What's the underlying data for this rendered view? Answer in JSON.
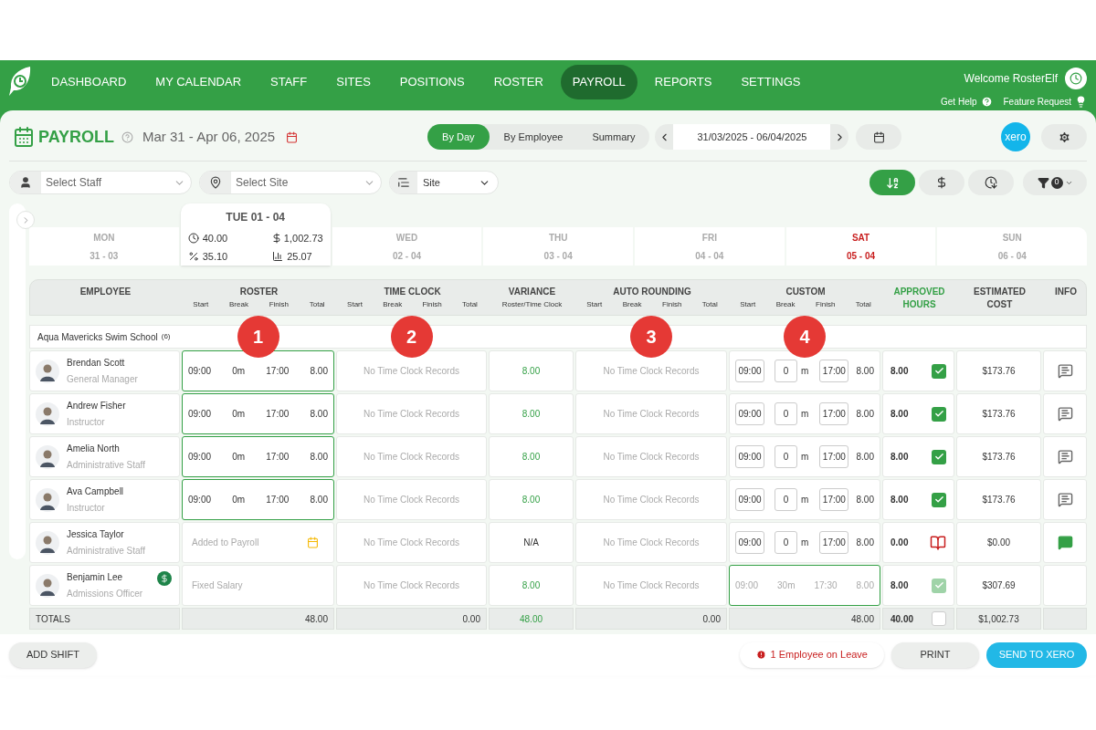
{
  "nav": {
    "items": [
      {
        "label": "DASHBOARD",
        "selected": false
      },
      {
        "label": "MY CALENDAR",
        "selected": false
      },
      {
        "label": "STAFF",
        "selected": false
      },
      {
        "label": "SITES",
        "selected": false
      },
      {
        "label": "POSITIONS",
        "selected": false
      },
      {
        "label": "ROSTER",
        "selected": false
      },
      {
        "label": "PAYROLL",
        "selected": true
      },
      {
        "label": "REPORTS",
        "selected": false
      },
      {
        "label": "SETTINGS",
        "selected": false
      }
    ],
    "welcome": "Welcome RosterElf",
    "help": "Get Help",
    "feature": "Feature Request"
  },
  "header": {
    "title": "PAYROLL",
    "period": "Mar 31 - Apr 06, 2025",
    "views": [
      {
        "label": "By Day",
        "selected": true
      },
      {
        "label": "By Employee",
        "selected": false
      },
      {
        "label": "Summary",
        "selected": false
      }
    ],
    "range": "31/03/2025 - 06/04/2025",
    "xero": "xero"
  },
  "filters": {
    "staff": {
      "placeholder": "Select Staff"
    },
    "site": {
      "placeholder": "Select Site"
    },
    "group_by": "Site"
  },
  "tools": [
    {
      "kind": "sort-name",
      "selected": true
    },
    {
      "kind": "cost",
      "selected": false
    },
    {
      "kind": "sort-time",
      "selected": false
    }
  ],
  "filter_count": "0",
  "days": [
    {
      "day": "MON",
      "date": "31 - 03",
      "selected": false,
      "highlighted": false
    },
    {
      "day": "TUE",
      "date": "01 - 04",
      "selected": true,
      "highlighted": false,
      "hours": "40.00",
      "cost": "1,002.73",
      "percent": "35.10",
      "average": "25.07"
    },
    {
      "day": "WED",
      "date": "02 - 04",
      "selected": false,
      "highlighted": false
    },
    {
      "day": "THU",
      "date": "03 - 04",
      "selected": false,
      "highlighted": false
    },
    {
      "day": "FRI",
      "date": "04 - 04",
      "selected": false,
      "highlighted": false
    },
    {
      "day": "SAT",
      "date": "05 - 04",
      "selected": false,
      "highlighted": true
    },
    {
      "day": "SUN",
      "date": "06 - 04",
      "selected": false,
      "highlighted": false
    }
  ],
  "columns": [
    {
      "title": "EMPLOYEE",
      "highlighted": false
    },
    {
      "title": "ROSTER",
      "sub": [
        "Start",
        "Break",
        "Finish",
        "Total"
      ],
      "marker": "1",
      "highlighted": false
    },
    {
      "title": "TIME CLOCK",
      "sub": [
        "Start",
        "Break",
        "Finish",
        "Total"
      ],
      "marker": "2",
      "highlighted": false
    },
    {
      "title": "VARIANCE",
      "sub": [
        "Roster/Time Clock"
      ],
      "highlighted": false
    },
    {
      "title": "AUTO ROUNDING",
      "sub": [
        "Start",
        "Break",
        "Finish",
        "Total"
      ],
      "marker": "3",
      "highlighted": false
    },
    {
      "title": "CUSTOM",
      "sub": [
        "Start",
        "Break",
        "Finish",
        "Total"
      ],
      "marker": "4",
      "highlighted": false
    },
    {
      "title": "APPROVED HOURS",
      "highlighted": true
    },
    {
      "title": "ESTIMATED COST",
      "highlighted": false
    },
    {
      "title": "INFO",
      "highlighted": false
    }
  ],
  "group": {
    "name": "Aqua Mavericks Swim School",
    "count": "(6)"
  },
  "rows": [
    {
      "name": "Brendan Scott",
      "role": "General Manager",
      "salary_badge": false,
      "roster": {
        "kind": "shift",
        "start": "09:00",
        "break": "0m",
        "finish": "17:00",
        "total": "8.00",
        "highlighted": true
      },
      "timeclock": "No Time Clock Records",
      "variance": {
        "text": "8.00",
        "kind": "match"
      },
      "rounding": "No Time Clock Records",
      "custom": {
        "kind": "inputs",
        "start": "09:00",
        "break": "0",
        "unit": "m",
        "finish": "17:00",
        "total": "8.00",
        "highlighted": false
      },
      "approved": "8.00",
      "approval": {
        "kind": "checkbox",
        "checked": true,
        "disabled": false
      },
      "cost": "$173.76",
      "info": {
        "kind": "comment",
        "filled": false
      }
    },
    {
      "name": "Andrew Fisher",
      "role": "Instructor",
      "salary_badge": false,
      "roster": {
        "kind": "shift",
        "start": "09:00",
        "break": "0m",
        "finish": "17:00",
        "total": "8.00",
        "highlighted": true
      },
      "timeclock": "No Time Clock Records",
      "variance": {
        "text": "8.00",
        "kind": "match"
      },
      "rounding": "No Time Clock Records",
      "custom": {
        "kind": "inputs",
        "start": "09:00",
        "break": "0",
        "unit": "m",
        "finish": "17:00",
        "total": "8.00",
        "highlighted": false
      },
      "approved": "8.00",
      "approval": {
        "kind": "checkbox",
        "checked": true,
        "disabled": false
      },
      "cost": "$173.76",
      "info": {
        "kind": "comment",
        "filled": false
      }
    },
    {
      "name": "Amelia North",
      "role": "Administrative Staff",
      "salary_badge": false,
      "roster": {
        "kind": "shift",
        "start": "09:00",
        "break": "0m",
        "finish": "17:00",
        "total": "8.00",
        "highlighted": true
      },
      "timeclock": "No Time Clock Records",
      "variance": {
        "text": "8.00",
        "kind": "match"
      },
      "rounding": "No Time Clock Records",
      "custom": {
        "kind": "inputs",
        "start": "09:00",
        "break": "0",
        "unit": "m",
        "finish": "17:00",
        "total": "8.00",
        "highlighted": false
      },
      "approved": "8.00",
      "approval": {
        "kind": "checkbox",
        "checked": true,
        "disabled": false
      },
      "cost": "$173.76",
      "info": {
        "kind": "comment",
        "filled": false
      }
    },
    {
      "name": "Ava Campbell",
      "role": "Instructor",
      "salary_badge": false,
      "roster": {
        "kind": "shift",
        "start": "09:00",
        "break": "0m",
        "finish": "17:00",
        "total": "8.00",
        "highlighted": true
      },
      "timeclock": "No Time Clock Records",
      "variance": {
        "text": "8.00",
        "kind": "match"
      },
      "rounding": "No Time Clock Records",
      "custom": {
        "kind": "inputs",
        "start": "09:00",
        "break": "0",
        "unit": "m",
        "finish": "17:00",
        "total": "8.00",
        "highlighted": false
      },
      "approved": "8.00",
      "approval": {
        "kind": "checkbox",
        "checked": true,
        "disabled": false
      },
      "cost": "$173.76",
      "info": {
        "kind": "comment",
        "filled": false
      }
    },
    {
      "name": "Jessica Taylor",
      "role": "Administrative Staff",
      "salary_badge": false,
      "roster": {
        "kind": "note",
        "text": "Added to Payroll",
        "calendar": true,
        "highlighted": false
      },
      "timeclock": "No Time Clock Records",
      "variance": {
        "text": "N/A",
        "kind": "none"
      },
      "rounding": "No Time Clock Records",
      "custom": {
        "kind": "inputs",
        "start": "09:00",
        "break": "0",
        "unit": "m",
        "finish": "17:00",
        "total": "8.00",
        "highlighted": false
      },
      "approved": "0.00",
      "approval": {
        "kind": "leave"
      },
      "cost": "$0.00",
      "info": {
        "kind": "comment",
        "filled": true
      }
    },
    {
      "name": "Benjamin Lee",
      "role": "Admissions Officer",
      "salary_badge": true,
      "roster": {
        "kind": "note",
        "text": "Fixed Salary",
        "calendar": false,
        "highlighted": false
      },
      "timeclock": "No Time Clock Records",
      "variance": {
        "text": "8.00",
        "kind": "match"
      },
      "rounding": "No Time Clock Records",
      "custom": {
        "kind": "fixed",
        "start": "09:00",
        "break": "30m",
        "finish": "17:30",
        "total": "8.00",
        "highlighted": true
      },
      "approved": "8.00",
      "approval": {
        "kind": "checkbox",
        "checked": true,
        "disabled": true
      },
      "cost": "$307.69",
      "info": {
        "kind": "none"
      }
    }
  ],
  "totals": {
    "label": "TOTALS",
    "roster": "48.00",
    "timeclock": "0.00",
    "variance": "48.00",
    "rounding": "0.00",
    "custom": "48.00",
    "approved": "40.00",
    "checked": false,
    "cost": "$1,002.73"
  },
  "footer": {
    "add_shift": "ADD SHIFT",
    "leave_notice": "1 Employee on Leave",
    "print": "PRINT",
    "send": "SEND TO XERO"
  }
}
